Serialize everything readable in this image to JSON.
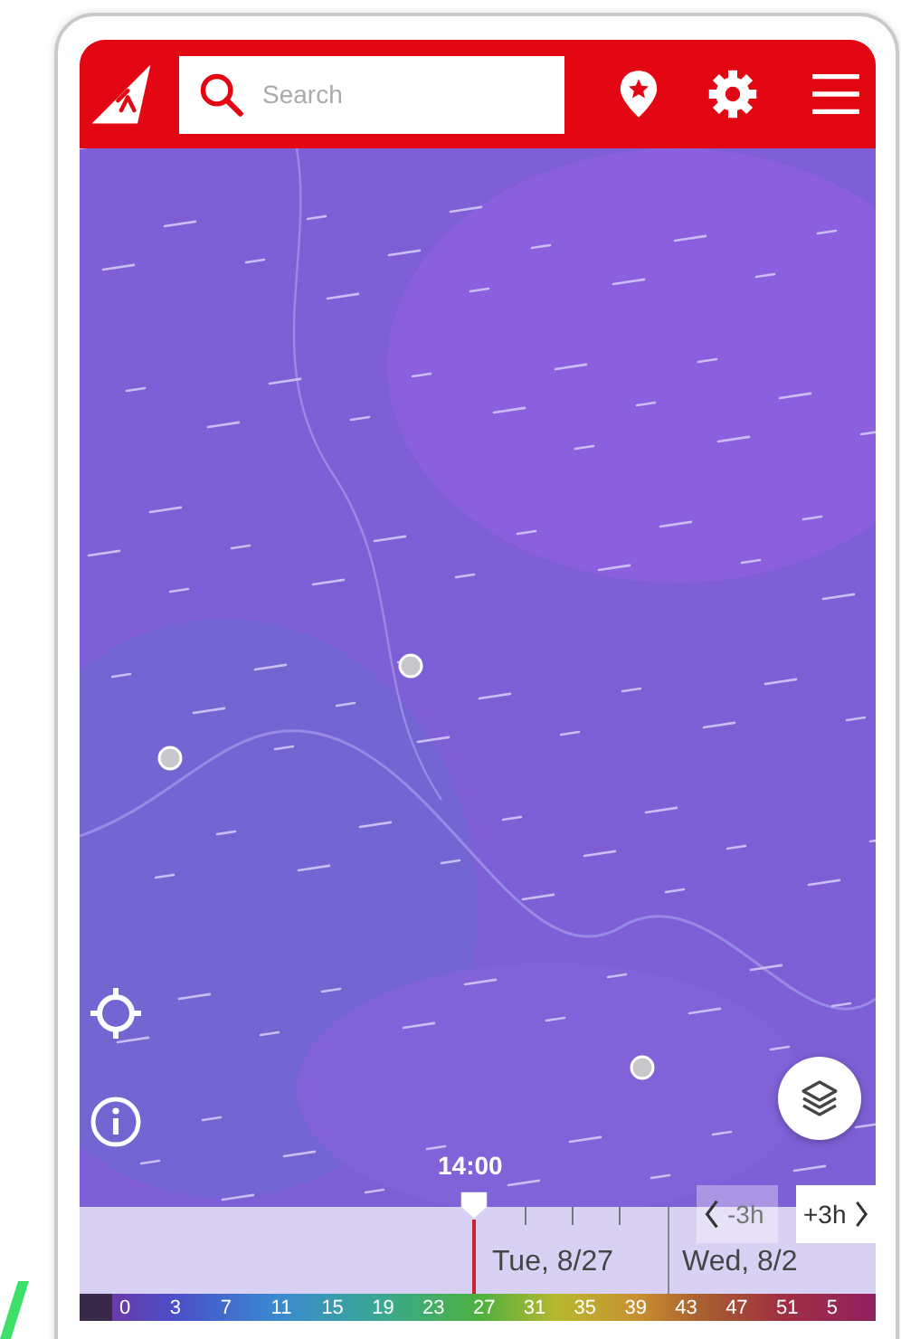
{
  "search": {
    "placeholder": "Search"
  },
  "timeline": {
    "current_time": "14:00",
    "days": [
      {
        "label": "Tue, 8/27"
      },
      {
        "label": "Wed, 8/2"
      }
    ],
    "step_buttons": [
      {
        "kind": "back",
        "label": "-3h",
        "disabled": true
      },
      {
        "kind": "forward",
        "label": "+3h",
        "disabled": false
      }
    ]
  },
  "legend": {
    "labels": [
      "0",
      "3",
      "7",
      "11",
      "15",
      "19",
      "23",
      "27",
      "31",
      "35",
      "39",
      "43",
      "47",
      "51",
      "5"
    ]
  }
}
